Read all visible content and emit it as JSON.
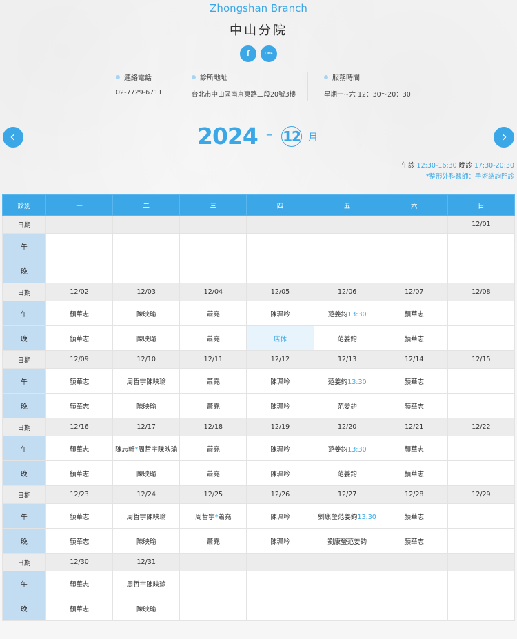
{
  "branch": {
    "name_en": "Zhongshan Branch",
    "name_zh": "中山分院"
  },
  "social": [
    {
      "label": "f",
      "icon": "facebook-icon"
    },
    {
      "label": "LINE",
      "icon": "line-icon"
    }
  ],
  "info": {
    "phone": {
      "label": "連絡電話",
      "value": "02-7729-6711"
    },
    "address": {
      "label": "診所地址",
      "value": "台北市中山區南京東路二段20號3樓"
    },
    "hours": {
      "label": "服務時間",
      "value": "星期一~六 12：30～20：30"
    }
  },
  "calendar": {
    "year": "2024",
    "dash": "–",
    "month": "12",
    "month_suffix": "月",
    "prev_icon": "chevron-left-icon",
    "next_icon": "chevron-right-icon"
  },
  "clinic_hours": {
    "afternoon_label": "午診",
    "afternoon_time": "12:30-16:30",
    "evening_label": "晚診",
    "evening_time": "17:30-20:30",
    "note": "*整形外科醫師：手術諮詢門診"
  },
  "colors": {
    "accent": "#3ba7e6",
    "label_cell": "#c2dcf1",
    "date_row": "#ececec"
  },
  "schedule": {
    "header": [
      "診別",
      "一",
      "二",
      "三",
      "四",
      "五",
      "六",
      "日"
    ],
    "date_label": "日期",
    "noon_label": "午",
    "evening_label": "晚",
    "weeks": [
      {
        "dates": [
          "",
          "",
          "",
          "",
          "",
          "",
          "12/01"
        ],
        "noon": [
          [],
          [],
          [],
          [],
          [],
          [],
          []
        ],
        "evening": [
          [],
          [],
          [],
          [],
          [],
          [],
          []
        ]
      },
      {
        "dates": [
          "12/02",
          "12/03",
          "12/04",
          "12/05",
          "12/06",
          "12/07",
          "12/08"
        ],
        "noon": [
          [
            "顏華志"
          ],
          [
            "陳映瑜"
          ],
          [
            "蕭堯"
          ],
          [
            "陳珮吟"
          ],
          [
            "范姜鈞",
            "13:30"
          ],
          [
            "顏華志"
          ],
          []
        ],
        "evening": [
          [
            "顏華志"
          ],
          [
            "陳映瑜"
          ],
          [
            "蕭堯"
          ],
          [
            "店休"
          ],
          [
            "范姜鈞"
          ],
          [
            "顏華志"
          ],
          []
        ]
      },
      {
        "dates": [
          "12/09",
          "12/10",
          "12/11",
          "12/12",
          "12/13",
          "12/14",
          "12/15"
        ],
        "noon": [
          [
            "顏華志"
          ],
          [
            "周哲宇陳映瑜"
          ],
          [
            "蕭堯"
          ],
          [
            "陳珮吟"
          ],
          [
            "范姜鈞",
            "13:30"
          ],
          [
            "顏華志"
          ],
          []
        ],
        "evening": [
          [
            "顏華志"
          ],
          [
            "陳映瑜"
          ],
          [
            "蕭堯"
          ],
          [
            "陳珮吟"
          ],
          [
            "范姜鈞"
          ],
          [
            "顏華志"
          ],
          []
        ]
      },
      {
        "dates": [
          "12/16",
          "12/17",
          "12/18",
          "12/19",
          "12/20",
          "12/21",
          "12/22"
        ],
        "noon": [
          [
            "顏華志"
          ],
          [
            "陳志軒",
            "*",
            "周哲宇陳映瑜"
          ],
          [
            "蕭堯"
          ],
          [
            "陳珮吟"
          ],
          [
            "范姜鈞",
            "13:30"
          ],
          [
            "顏華志"
          ],
          []
        ],
        "evening": [
          [
            "顏華志"
          ],
          [
            "陳映瑜"
          ],
          [
            "蕭堯"
          ],
          [
            "陳珮吟"
          ],
          [
            "范姜鈞"
          ],
          [
            "顏華志"
          ],
          []
        ]
      },
      {
        "dates": [
          "12/23",
          "12/24",
          "12/25",
          "12/26",
          "12/27",
          "12/28",
          "12/29"
        ],
        "noon": [
          [
            "顏華志"
          ],
          [
            "周哲宇陳映瑜"
          ],
          [
            "周哲宇",
            "*",
            "蕭堯"
          ],
          [
            "陳珮吟"
          ],
          [
            "劉康瑩范姜鈞",
            "13:30"
          ],
          [
            "顏華志"
          ],
          []
        ],
        "evening": [
          [
            "顏華志"
          ],
          [
            "陳映瑜"
          ],
          [
            "蕭堯"
          ],
          [
            "陳珮吟"
          ],
          [
            "劉康瑩范姜鈞"
          ],
          [
            "顏華志"
          ],
          []
        ]
      },
      {
        "dates": [
          "12/30",
          "12/31",
          "",
          "",
          "",
          "",
          ""
        ],
        "noon": [
          [
            "顏華志"
          ],
          [
            "周哲宇陳映瑜"
          ],
          [],
          [],
          [],
          [],
          []
        ],
        "evening": [
          [
            "顏華志"
          ],
          [
            "陳映瑜"
          ],
          [],
          [],
          [],
          [],
          []
        ]
      }
    ]
  }
}
